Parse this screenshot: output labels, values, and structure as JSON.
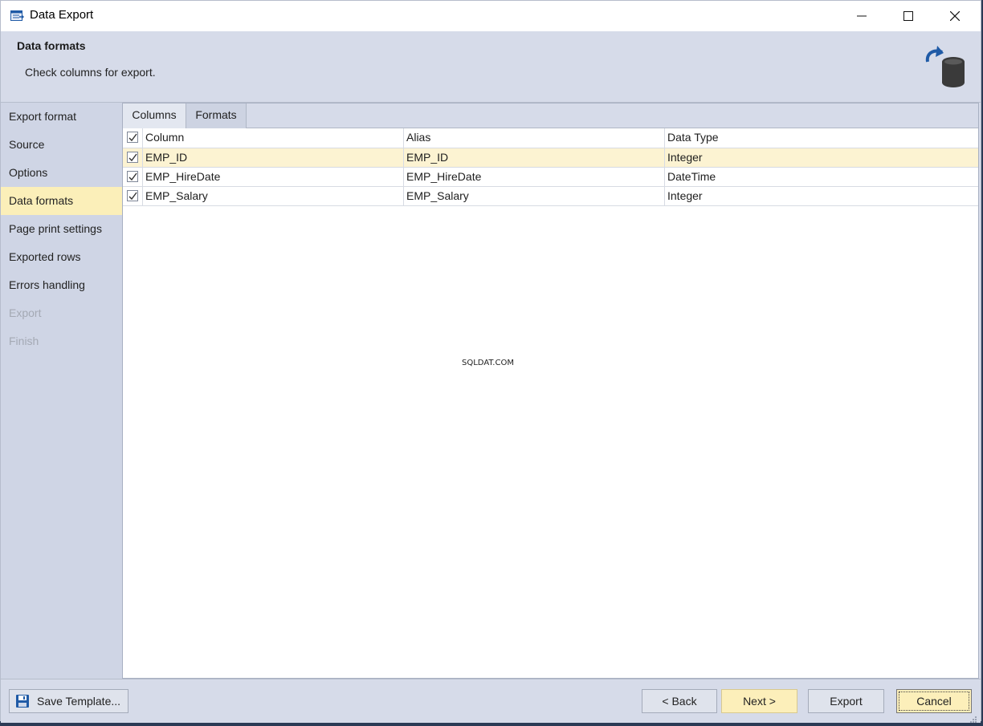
{
  "window": {
    "title": "Data Export"
  },
  "header": {
    "title": "Data formats",
    "subtitle": "Check columns for export."
  },
  "sidebar": {
    "items": [
      {
        "label": "Export format",
        "state": "normal"
      },
      {
        "label": "Source",
        "state": "normal"
      },
      {
        "label": "Options",
        "state": "normal"
      },
      {
        "label": "Data formats",
        "state": "active"
      },
      {
        "label": "Page print settings",
        "state": "normal"
      },
      {
        "label": "Exported rows",
        "state": "normal"
      },
      {
        "label": "Errors handling",
        "state": "normal"
      },
      {
        "label": "Export",
        "state": "disabled"
      },
      {
        "label": "Finish",
        "state": "disabled"
      }
    ]
  },
  "tabs": {
    "columns": "Columns",
    "formats": "Formats",
    "active": "columns"
  },
  "grid": {
    "headers": {
      "column": "Column",
      "alias": "Alias",
      "type": "Data Type"
    },
    "header_checked": true,
    "rows": [
      {
        "checked": true,
        "column": "EMP_ID",
        "alias": "EMP_ID",
        "type": "Integer",
        "selected": true
      },
      {
        "checked": true,
        "column": "EMP_HireDate",
        "alias": "EMP_HireDate",
        "type": "DateTime",
        "selected": false
      },
      {
        "checked": true,
        "column": "EMP_Salary",
        "alias": "EMP_Salary",
        "type": "Integer",
        "selected": false
      }
    ]
  },
  "watermark": "SQLDAT.COM",
  "footer": {
    "save_template": "Save Template...",
    "back": "< Back",
    "next": "Next >",
    "export": "Export",
    "cancel": "Cancel"
  },
  "icons": {
    "title": "data-export-icon",
    "header": "database-export-icon",
    "save": "floppy-disk-icon",
    "check": "checkmark-icon"
  },
  "colors": {
    "active_nav": "#fbefb9",
    "selected_row": "#fcf3d2",
    "primary_button": "#fcefba",
    "accent_blue": "#1f5aa6"
  }
}
